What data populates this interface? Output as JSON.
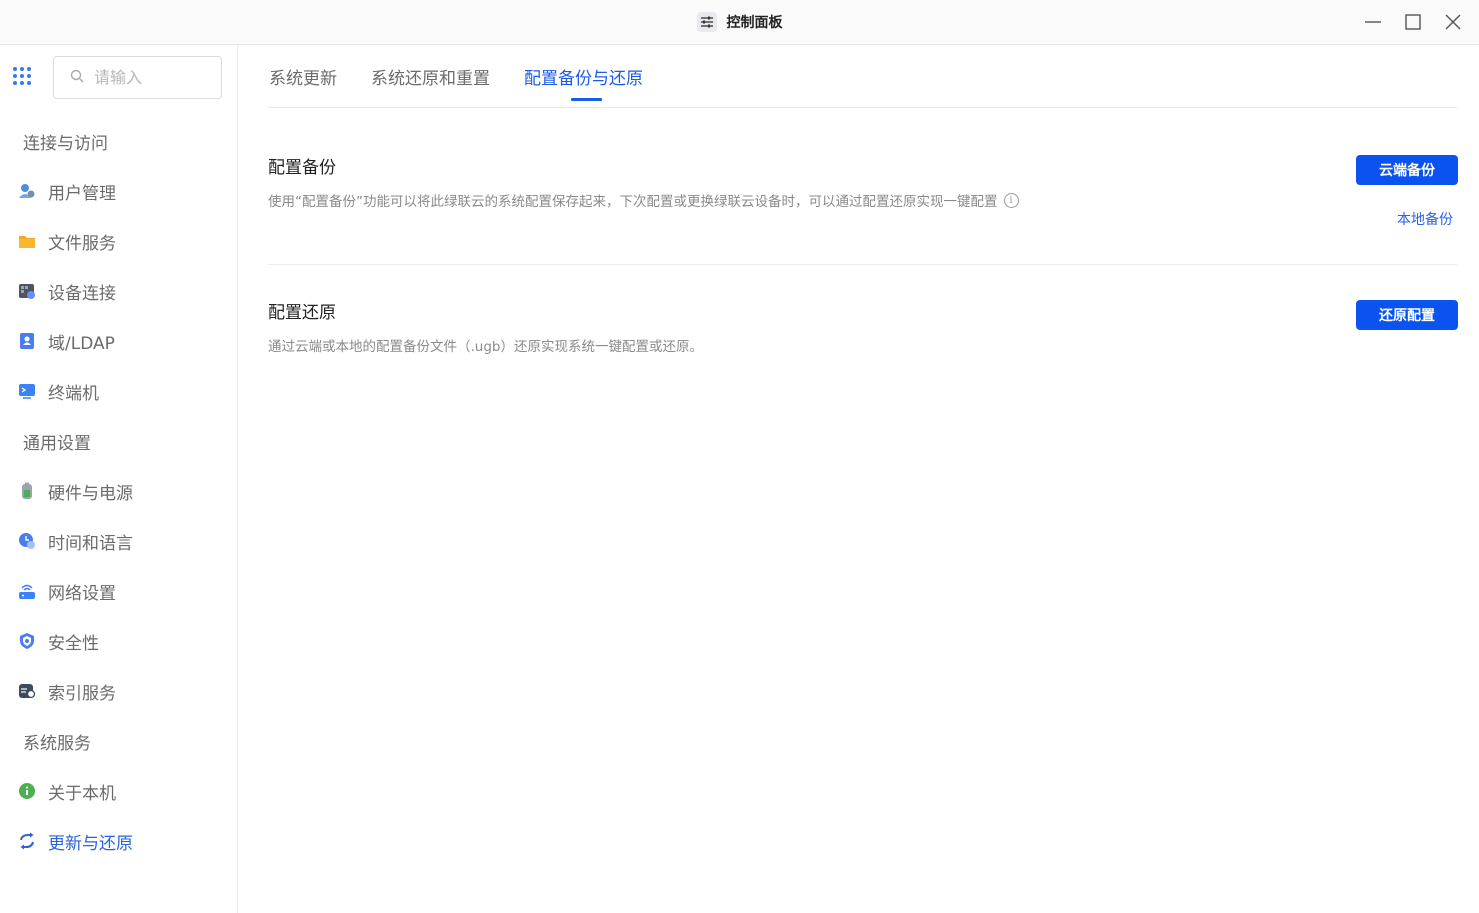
{
  "window": {
    "title": "控制面板",
    "app_icon": "sliders-icon",
    "controls": [
      "minimize-icon",
      "maximize-icon",
      "close-icon"
    ]
  },
  "sidebar": {
    "search": {
      "placeholder": "请输入",
      "value": ""
    },
    "groups": [
      {
        "title": "连接与访问",
        "items": [
          {
            "label": "用户管理",
            "icon": "users-icon"
          },
          {
            "label": "文件服务",
            "icon": "folder-icon"
          },
          {
            "label": "设备连接",
            "icon": "device-icon"
          },
          {
            "label": "域/LDAP",
            "icon": "contact-card-icon"
          },
          {
            "label": "终端机",
            "icon": "terminal-icon"
          }
        ]
      },
      {
        "title": "通用设置",
        "items": [
          {
            "label": "硬件与电源",
            "icon": "battery-icon"
          },
          {
            "label": "时间和语言",
            "icon": "clock-icon"
          },
          {
            "label": "网络设置",
            "icon": "router-icon"
          },
          {
            "label": "安全性",
            "icon": "shield-icon"
          },
          {
            "label": "索引服务",
            "icon": "index-icon"
          }
        ]
      },
      {
        "title": "系统服务",
        "items": [
          {
            "label": "关于本机",
            "icon": "info-icon"
          },
          {
            "label": "更新与还原",
            "icon": "refresh-icon",
            "active": true
          }
        ]
      }
    ]
  },
  "tabs": [
    {
      "label": "系统更新"
    },
    {
      "label": "系统还原和重置"
    },
    {
      "label": "配置备份与还原",
      "active": true
    }
  ],
  "sections": {
    "backup": {
      "title": "配置备份",
      "description": "使用“配置备份”功能可以将此绿联云的系统配置保存起来，下次配置或更换绿联云设备时，可以通过配置还原实现一键配置",
      "primary_button": "云端备份",
      "secondary_link": "本地备份"
    },
    "restore": {
      "title": "配置还原",
      "description": "通过云端或本地的配置备份文件（.ugb）还原实现系统一键配置或还原。",
      "primary_button": "还原配置"
    }
  },
  "colors": {
    "accent": "#0a53f0",
    "active_text": "#1b5be8",
    "muted_text": "#6b6b6b"
  }
}
